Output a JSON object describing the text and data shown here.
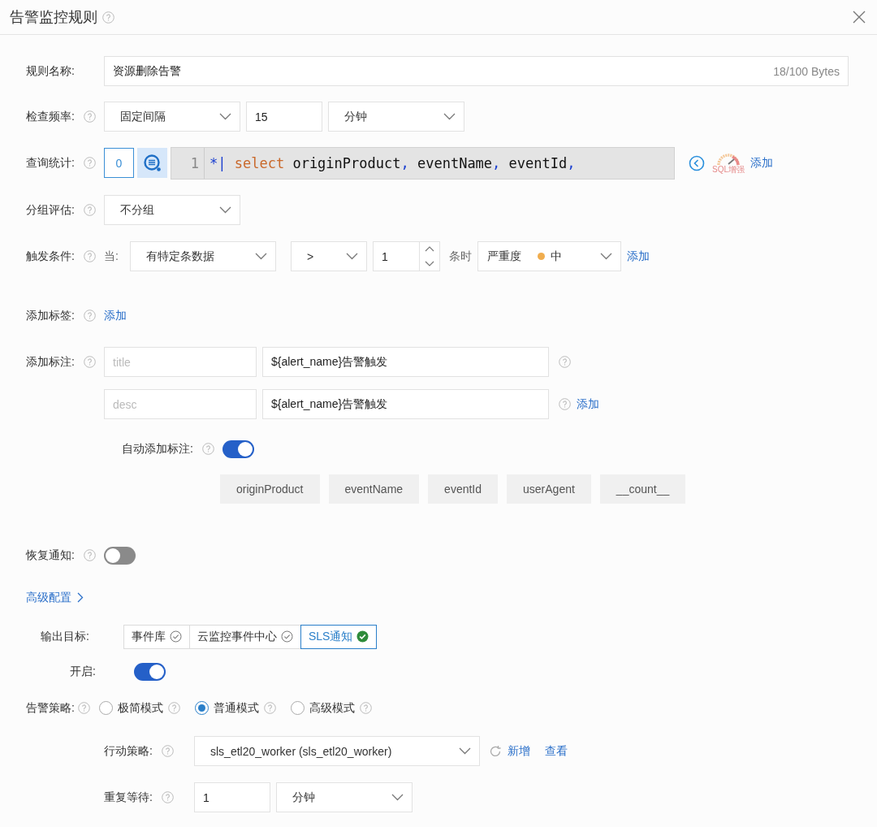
{
  "dialog": {
    "title": "告警监控规则"
  },
  "rule_name": {
    "label": "规则名称:",
    "help": false,
    "value": "资源删除告警",
    "counter": "18/100 Bytes"
  },
  "check_frequency": {
    "label": "检查频率:",
    "help": true,
    "mode": "固定间隔",
    "interval": "15",
    "unit": "分钟"
  },
  "query": {
    "label": "查询统计:",
    "help": true,
    "index": "0",
    "line_number": "1",
    "tokens": [
      {
        "kind": "operator",
        "text": "*|"
      },
      {
        "kind": "keyword",
        "text": "select"
      },
      {
        "kind": "identifier",
        "text": "originProduct"
      },
      {
        "kind": "punct",
        "text": ","
      },
      {
        "kind": "identifier",
        "text": "eventName"
      },
      {
        "kind": "punct",
        "text": ","
      },
      {
        "kind": "identifier",
        "text": "eventId"
      },
      {
        "kind": "punct",
        "text": ","
      }
    ],
    "sql_boost": "SQL增强",
    "add": "添加"
  },
  "grouping": {
    "label": "分组评估:",
    "help": true,
    "value": "不分组"
  },
  "trigger": {
    "label": "触发条件:",
    "help": true,
    "when": "当:",
    "condition": "有特定条数据",
    "operator": ">",
    "count": "1",
    "suffix": "条时",
    "severity": {
      "label": "严重度",
      "value": "中",
      "color": "#f0ad4e"
    },
    "add": "添加"
  },
  "labels": {
    "label": "添加标签:",
    "help": true,
    "add": "添加"
  },
  "annotations": {
    "label": "添加标注:",
    "help": true,
    "items": [
      {
        "placeholder": "title",
        "value": "${alert_name}告警触发"
      },
      {
        "placeholder": "desc",
        "value": "${alert_name}告警触发"
      }
    ],
    "add": "添加"
  },
  "auto_annotation": {
    "label": "自动添加标注:",
    "help": true,
    "on": true,
    "fields": [
      "originProduct",
      "eventName",
      "eventId",
      "userAgent",
      "__count__"
    ]
  },
  "recovery": {
    "label": "恢复通知:",
    "help": true,
    "on": false
  },
  "advanced": {
    "label": "高级配置"
  },
  "output": {
    "label": "输出目标:",
    "targets": [
      {
        "label": "事件库",
        "selected": false
      },
      {
        "label": "云监控事件中心",
        "selected": false
      },
      {
        "label": "SLS通知",
        "selected": true
      }
    ]
  },
  "enable": {
    "label": "开启:",
    "on": true
  },
  "strategy": {
    "label": "告警策略:",
    "help": true,
    "modes": [
      {
        "label": "极简模式",
        "selected": false
      },
      {
        "label": "普通模式",
        "selected": true
      },
      {
        "label": "高级模式",
        "selected": false
      }
    ]
  },
  "action": {
    "label": "行动策略:",
    "help": true,
    "value": "sls_etl20_worker (sls_etl20_worker)",
    "links": [
      "新增",
      "查看"
    ]
  },
  "repeat": {
    "label": "重复等待:",
    "help": true,
    "value": "1",
    "unit": "分钟"
  }
}
